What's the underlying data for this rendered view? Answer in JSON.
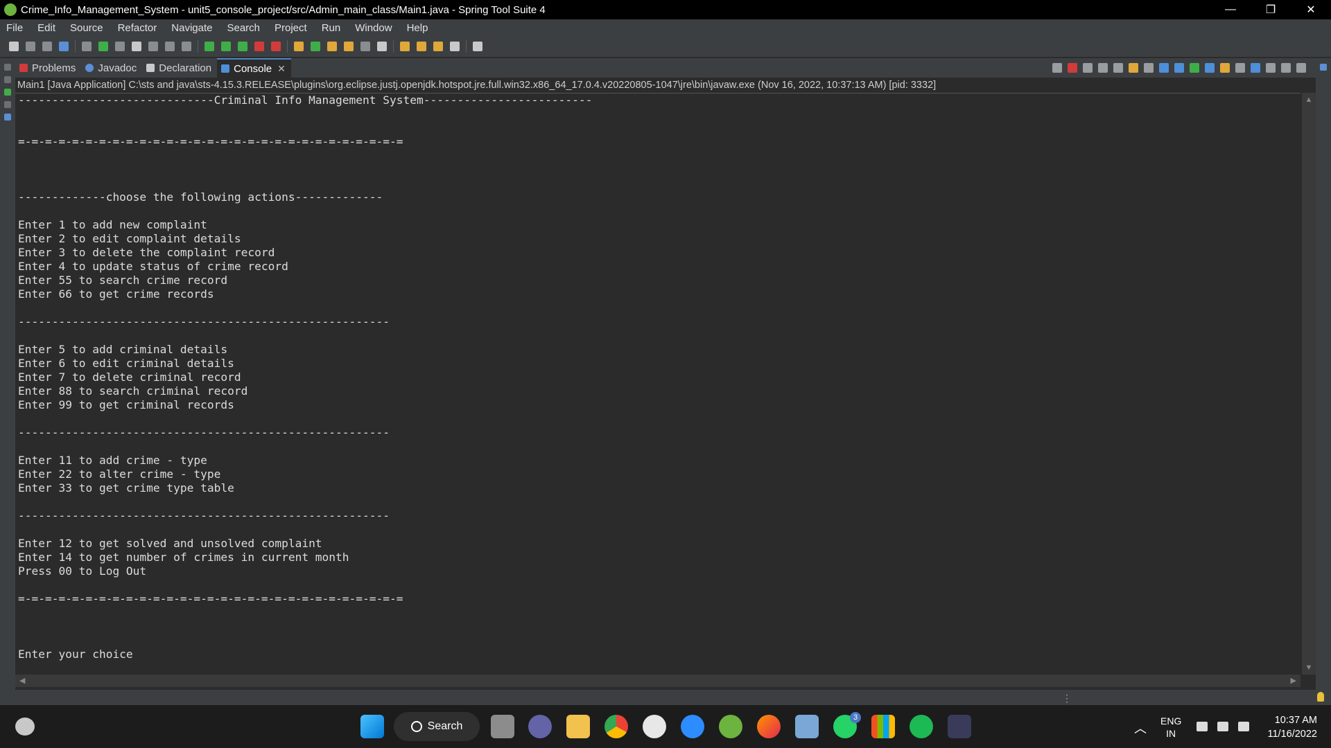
{
  "window": {
    "title": "Crime_Info_Management_System - unit5_console_project/src/Admin_main_class/Main1.java - Spring Tool Suite 4",
    "minimize": "—",
    "maximize": "❐",
    "close": "✕"
  },
  "menu": [
    "File",
    "Edit",
    "Source",
    "Refactor",
    "Navigate",
    "Search",
    "Project",
    "Run",
    "Window",
    "Help"
  ],
  "tabs": {
    "problems": "Problems",
    "javadoc": "Javadoc",
    "declaration": "Declaration",
    "console": "Console",
    "close": "✕"
  },
  "console_info": "Main1 [Java Application] C:\\sts and java\\sts-4.15.3.RELEASE\\plugins\\org.eclipse.justj.openjdk.hotspot.jre.full.win32.x86_64_17.0.4.v20220805-1047\\jre\\bin\\javaw.exe  (Nov 16, 2022, 10:37:13 AM) [pid: 3332]",
  "console_output": "-----------------------------Criminal Info Management System-------------------------\n\n\n=-=-=-=-=-=-=-=-=-=-=-=-=-=-=-=-=-=-=-=-=-=-=-=-=-=-=-=-=\n\n\n\n-------------choose the following actions-------------\n\nEnter 1 to add new complaint\nEnter 2 to edit complaint details\nEnter 3 to delete the complaint record\nEnter 4 to update status of crime record\nEnter 55 to search crime record\nEnter 66 to get crime records\n\n-------------------------------------------------------\n\nEnter 5 to add criminal details\nEnter 6 to edit criminal details\nEnter 7 to delete criminal record\nEnter 88 to search criminal record\nEnter 99 to get criminal records\n\n-------------------------------------------------------\n\nEnter 11 to add crime - type\nEnter 22 to alter crime - type\nEnter 33 to get crime type table\n\n-------------------------------------------------------\n\nEnter 12 to get solved and unsolved complaint\nEnter 14 to get number of crimes in current month\nPress 00 to Log Out\n\n=-=-=-=-=-=-=-=-=-=-=-=-=-=-=-=-=-=-=-=-=-=-=-=-=-=-=-=-=\n\n\n\nEnter your choice",
  "scroll": {
    "up": "▲",
    "down": "▼",
    "left": "◀",
    "right": "▶"
  },
  "taskbar": {
    "search_label": "Search",
    "whatsapp_badge": "3",
    "language_line1": "ENG",
    "language_line2": "IN",
    "time": "10:37 AM",
    "date": "11/16/2022"
  },
  "colors": {
    "accent": "#4a88c7",
    "spring_green": "#6db33f",
    "stop_red": "#d23b3b"
  }
}
